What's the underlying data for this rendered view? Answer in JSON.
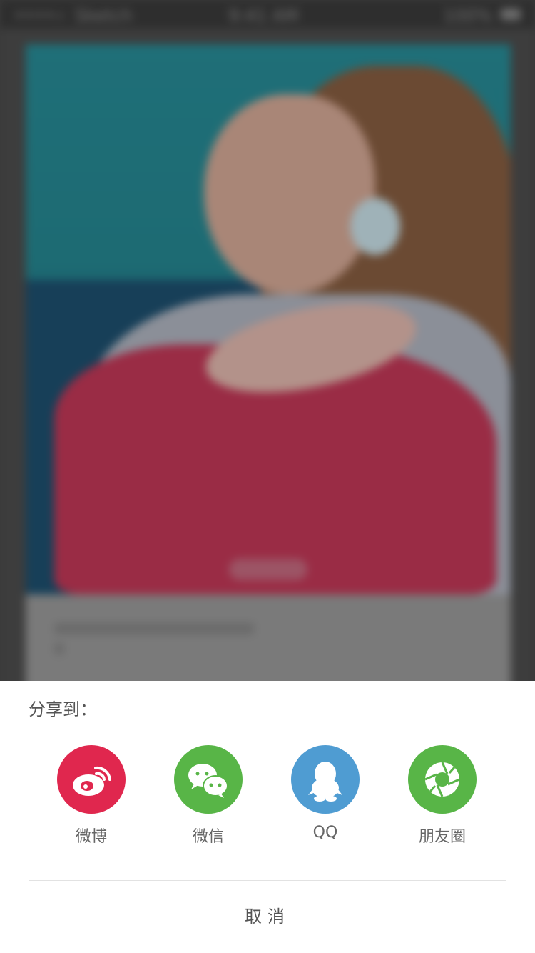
{
  "status_bar": {
    "carrier": "••••∘",
    "network": "Sketch",
    "time": "9:41 AM",
    "battery": "100%"
  },
  "share": {
    "title": "分享到：",
    "items": [
      {
        "label": "微博",
        "icon": "weibo-icon",
        "color": "#e0274e"
      },
      {
        "label": "微信",
        "icon": "wechat-icon",
        "color": "#58b547"
      },
      {
        "label": "QQ",
        "icon": "qq-icon",
        "color": "#4f9cd2"
      },
      {
        "label": "朋友圈",
        "icon": "moments-icon",
        "color": "#58b547"
      }
    ],
    "cancel_label": "取消"
  }
}
